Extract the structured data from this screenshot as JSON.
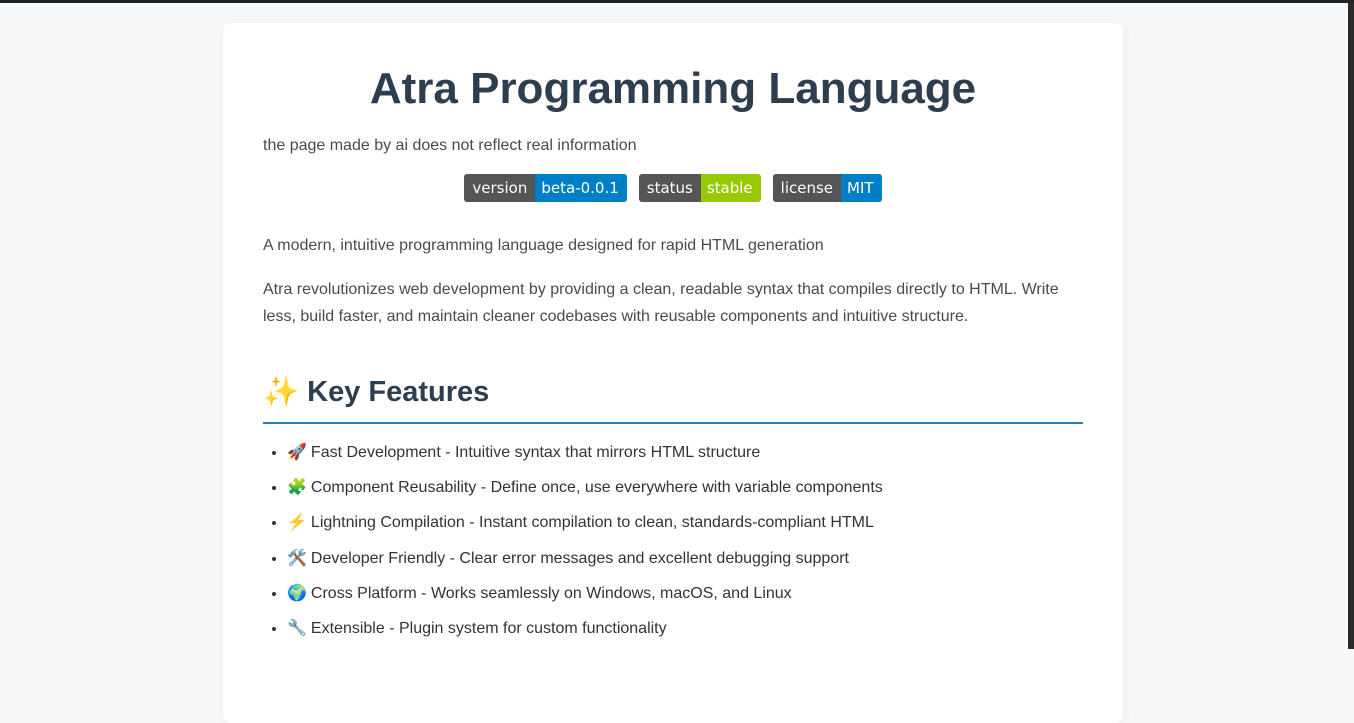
{
  "colors": {
    "heading": "#2c3e50",
    "accent_underline": "#2e7db5",
    "badge_key_bg": "#555555"
  },
  "page": {
    "title": "Atra Programming Language",
    "disclaimer": "the page made by ai does not reflect real information",
    "badges": [
      {
        "key": "version",
        "value": "beta-0.0.1",
        "color": "#007ec6"
      },
      {
        "key": "status",
        "value": "stable",
        "color": "#97ca00"
      },
      {
        "key": "license",
        "value": "MIT",
        "color": "#007ec6"
      }
    ],
    "tagline": "A modern, intuitive programming language designed for rapid HTML generation",
    "intro": "Atra revolutionizes web development by providing a clean, readable syntax that compiles directly to HTML. Write less, build faster, and maintain cleaner codebases with reusable components and intuitive structure.",
    "features_heading_icon": "✨",
    "features_heading": "Key Features",
    "features": [
      {
        "icon": "🚀",
        "icon_name": "rocket-icon",
        "text": "Fast Development - Intuitive syntax that mirrors HTML structure"
      },
      {
        "icon": "🧩",
        "icon_name": "puzzle-icon",
        "text": "Component Reusability - Define once, use everywhere with variable components"
      },
      {
        "icon": "⚡",
        "icon_name": "lightning-icon",
        "text": "Lightning Compilation - Instant compilation to clean, standards-compliant HTML"
      },
      {
        "icon": "🛠️",
        "icon_name": "tools-icon",
        "text": "Developer Friendly - Clear error messages and excellent debugging support"
      },
      {
        "icon": "🌍",
        "icon_name": "globe-icon",
        "text": "Cross Platform - Works seamlessly on Windows, macOS, and Linux"
      },
      {
        "icon": "🔧",
        "icon_name": "wrench-icon",
        "text": "Extensible - Plugin system for custom functionality"
      }
    ]
  }
}
